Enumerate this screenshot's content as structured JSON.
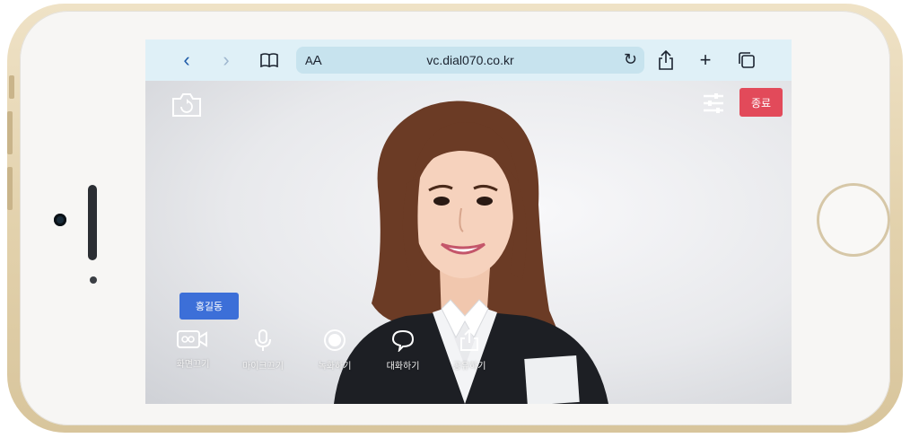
{
  "browser": {
    "url": "vc.dial070.co.kr",
    "reader_small": "A",
    "reader_big": "A",
    "back_icon": "‹",
    "forward_icon": "›",
    "reload_icon": "↻",
    "new_tab_icon": "+"
  },
  "call": {
    "end_label": "종료",
    "name_badge": "홍길동",
    "controls": [
      {
        "label": "화면끄기",
        "icon": "camera-off-icon"
      },
      {
        "label": "마이크끄기",
        "icon": "microphone-icon"
      },
      {
        "label": "녹화하기",
        "icon": "record-icon"
      },
      {
        "label": "대화하기",
        "icon": "chat-bubble-icon"
      },
      {
        "label": "공유하기",
        "icon": "share-icon"
      }
    ]
  },
  "colors": {
    "browser_bar": "#dff0f7",
    "accent_link": "#1e5aa8",
    "end_button": "#e24a5a",
    "name_badge": "#3c6fd8"
  }
}
